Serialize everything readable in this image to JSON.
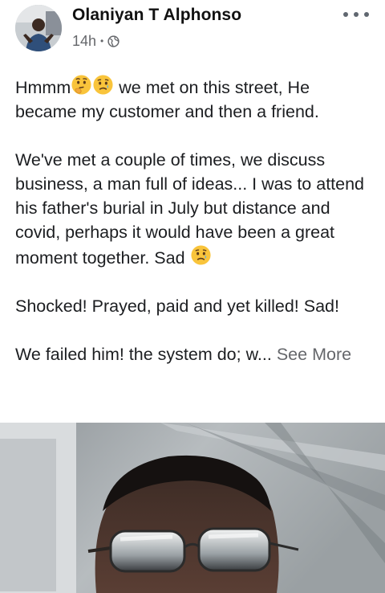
{
  "post": {
    "author_name": "Olaniyan T Alphonso",
    "timestamp": "14h",
    "separator": "•",
    "audience_icon": "globe-icon",
    "more_icon": "more-options-icon",
    "paragraphs": {
      "p1_start": "Hmmm",
      "p1_rest": " we met on this street, He became my customer and then a friend.",
      "p2": "We've met a couple of times, we discuss business, a man full of ideas... I was to attend his father's burial in July but distance and covid, perhaps it would have been a great moment together. Sad",
      "p3": "Shocked! Prayed, paid and yet killed! Sad!",
      "p4": "We failed him! the system do; w...",
      "see_more": "See More"
    },
    "emojis": [
      "thinking-face",
      "sad-face",
      "sad-face"
    ]
  },
  "colors": {
    "text": "#1c1e21",
    "secondary": "#65676b",
    "icon": "#606770"
  }
}
